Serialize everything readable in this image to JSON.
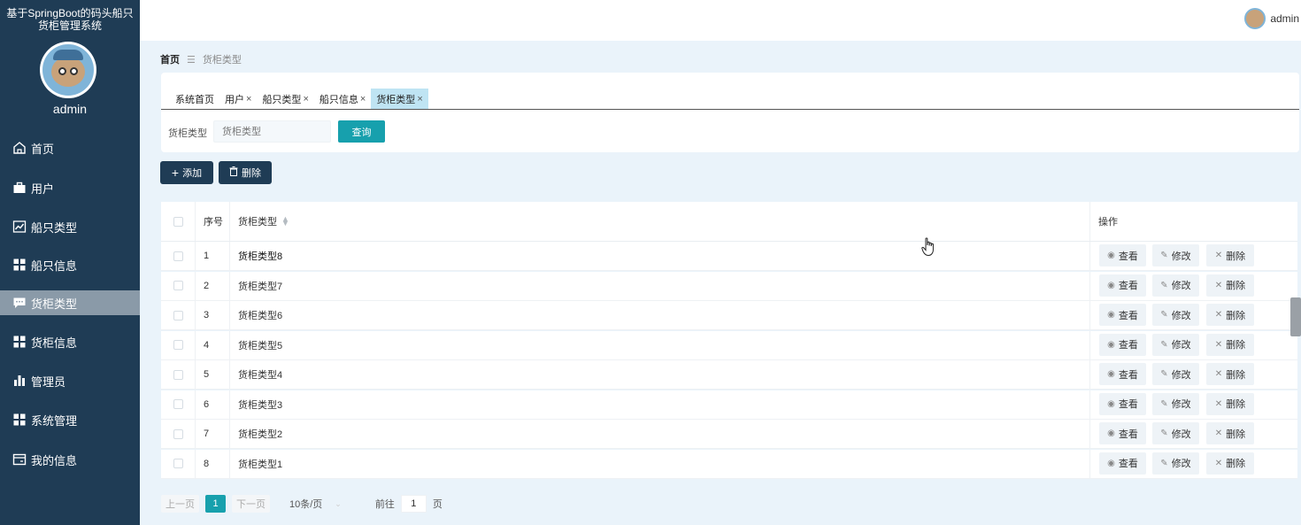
{
  "app": {
    "title_line1": "基于SpringBoot的码头船只",
    "title_line2": "货柜管理系统"
  },
  "sidebar": {
    "username": "admin",
    "items": [
      {
        "label": "首页",
        "icon": "home-icon",
        "active": false
      },
      {
        "label": "用户",
        "icon": "briefcase-icon",
        "active": false
      },
      {
        "label": "船只类型",
        "icon": "chart-line-icon",
        "active": false
      },
      {
        "label": "船只信息",
        "icon": "grid-icon",
        "active": false
      },
      {
        "label": "货柜类型",
        "icon": "chat-icon",
        "active": true
      },
      {
        "label": "货柜信息",
        "icon": "grid-icon",
        "active": false
      },
      {
        "label": "管理员",
        "icon": "bar-chart-icon",
        "active": false
      },
      {
        "label": "系统管理",
        "icon": "grid-icon",
        "active": false
      },
      {
        "label": "我的信息",
        "icon": "card-icon",
        "active": false
      }
    ]
  },
  "header": {
    "username": "admin"
  },
  "breadcrumb": {
    "home": "首页",
    "separator": "☰",
    "current": "货柜类型"
  },
  "tabs": [
    {
      "label": "系统首页",
      "closable": false,
      "active": false
    },
    {
      "label": "用户",
      "closable": true,
      "active": false
    },
    {
      "label": "船只类型",
      "closable": true,
      "active": false
    },
    {
      "label": "船只信息",
      "closable": true,
      "active": false
    },
    {
      "label": "货柜类型",
      "closable": true,
      "active": true
    }
  ],
  "tab_close_glyph": "×",
  "search": {
    "label": "货柜类型",
    "placeholder": "货柜类型",
    "button": "查询"
  },
  "actions": {
    "add": "添加",
    "delete": "删除"
  },
  "table": {
    "headers": {
      "index": "序号",
      "name": "货柜类型",
      "ops": "操作"
    },
    "rows": [
      {
        "index": "1",
        "name": "货柜类型8"
      },
      {
        "index": "2",
        "name": "货柜类型7"
      },
      {
        "index": "3",
        "name": "货柜类型6"
      },
      {
        "index": "4",
        "name": "货柜类型5"
      },
      {
        "index": "5",
        "name": "货柜类型4"
      },
      {
        "index": "6",
        "name": "货柜类型3"
      },
      {
        "index": "7",
        "name": "货柜类型2"
      },
      {
        "index": "8",
        "name": "货柜类型1"
      }
    ],
    "row_actions": {
      "view": "查看",
      "edit": "修改",
      "delete": "删除"
    }
  },
  "pagination": {
    "prev": "上一页",
    "current": "1",
    "next": "下一页",
    "page_size": "10条/页",
    "goto_label": "前往",
    "goto_value": "1",
    "page_unit": "页"
  },
  "colors": {
    "sidebar_bg": "#1f3c55",
    "accent": "#17a0ad",
    "active_tab": "#bfe4f3",
    "content_bg": "#eaf3fa"
  }
}
